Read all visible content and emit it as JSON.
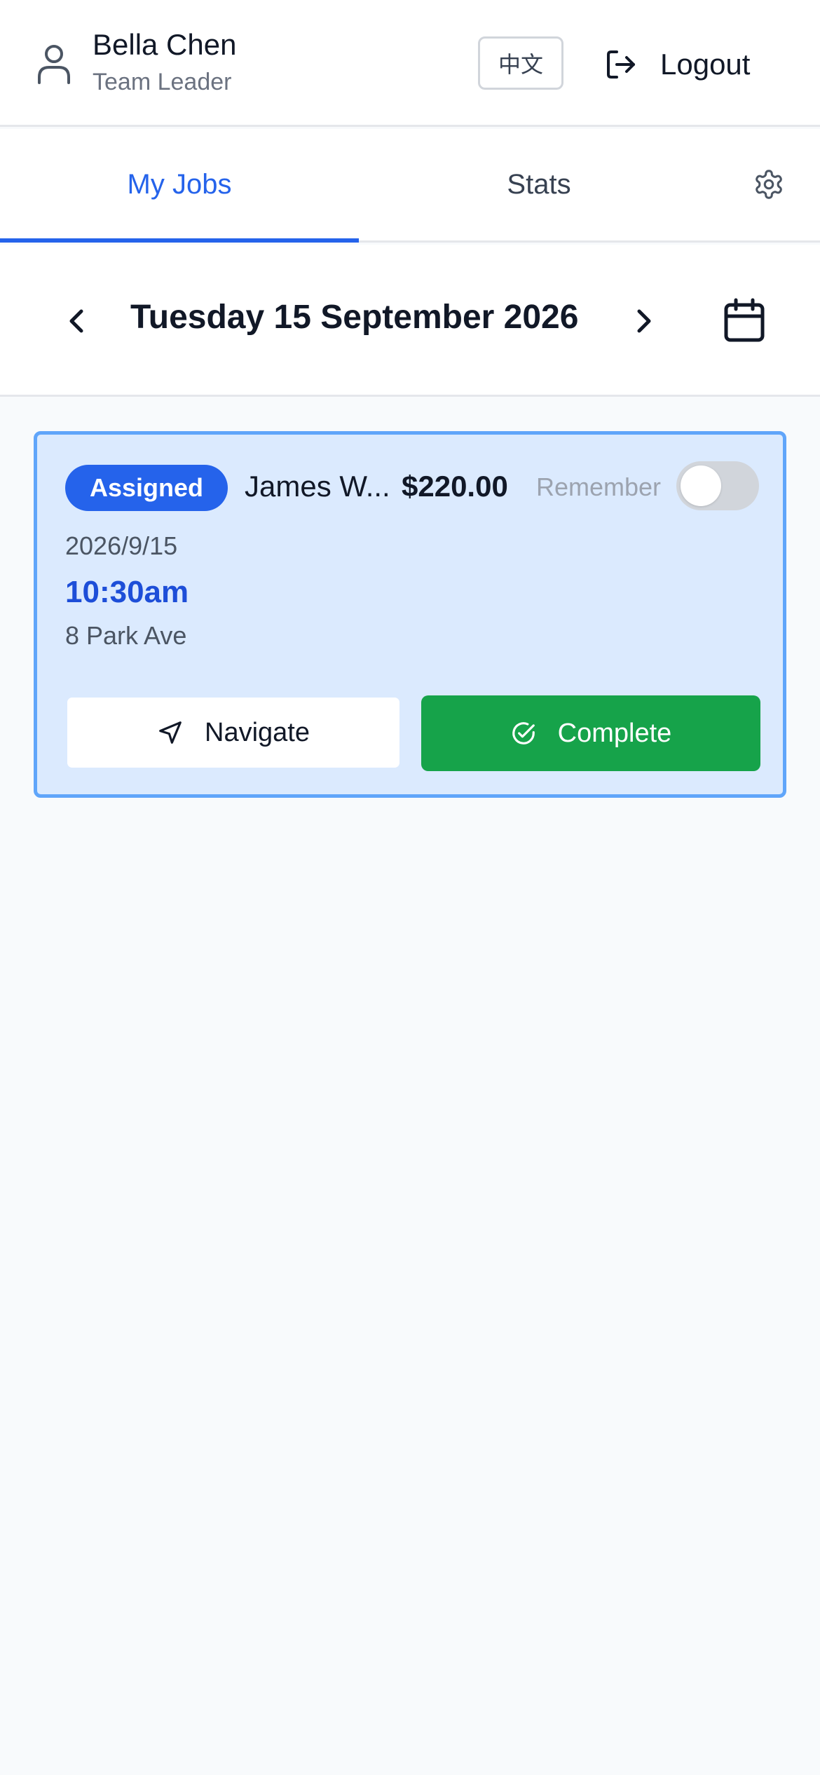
{
  "header": {
    "user_name": "Bella Chen",
    "user_role": "Team Leader",
    "language_label": "中文",
    "logout_label": "Logout"
  },
  "tabs": [
    {
      "label": "My Jobs",
      "active": true
    },
    {
      "label": "Stats",
      "active": false
    }
  ],
  "date_nav": {
    "current_date": "Tuesday 15 September 2026"
  },
  "jobs": [
    {
      "status": "Assigned",
      "client": "James W...",
      "price": "$220.00",
      "remember_label": "Remember",
      "remember_on": false,
      "date": "2026/9/15",
      "time": "10:30am",
      "address": "8 Park Ave",
      "navigate_label": "Navigate",
      "complete_label": "Complete"
    }
  ],
  "colors": {
    "accent": "#2563eb",
    "card_bg": "#dbeafe",
    "card_border": "#60a5fa",
    "success": "#16a34a"
  },
  "icons": {
    "user": "user-icon",
    "logout": "logout-icon",
    "settings": "gear-icon",
    "prev": "chevron-left-icon",
    "next": "chevron-right-icon",
    "calendar": "calendar-icon",
    "navigate": "navigation-arrow-icon",
    "complete": "check-circle-icon"
  }
}
